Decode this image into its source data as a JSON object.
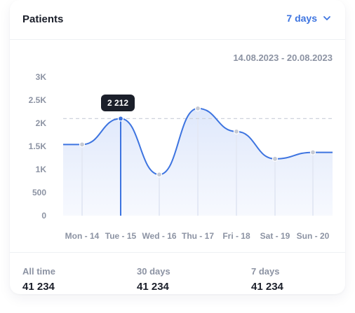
{
  "card": {
    "title": "Patients",
    "range_select": {
      "label": "7 days",
      "icon": "chevron-down-icon"
    },
    "date_range": "14.08.2023 - 20.08.2023"
  },
  "chart_data": {
    "type": "area",
    "categories": [
      "Mon - 14",
      "Tue - 15",
      "Wed - 16",
      "Thu - 17",
      "Fri - 18",
      "Sat - 19",
      "Sun - 20"
    ],
    "values": [
      1540,
      2100,
      890,
      2320,
      1820,
      1230,
      1370
    ],
    "y_ticks": [
      "0",
      "500",
      "1K",
      "1.5K",
      "2K",
      "2.5K",
      "3K"
    ],
    "ylim": [
      0,
      3000
    ],
    "highlight_index": 1,
    "tooltip": "2 212",
    "reference_value": 2100,
    "colors": {
      "line": "#3d74e0",
      "fill_top": "#dfe8fb",
      "fill_bottom": "#f7f9fe",
      "point": "#c5c9d3",
      "drop_line": "#e4e9f5",
      "highlight_line": "#3d74e0",
      "reference_line": "#cfd3dc",
      "axis_text": "#8c93a3",
      "tooltip_bg": "#1b1f2a"
    }
  },
  "footer": {
    "stats": [
      {
        "label": "All time",
        "value": "41 234"
      },
      {
        "label": "30 days",
        "value": "41 234"
      },
      {
        "label": "7 days",
        "value": "41 234"
      }
    ]
  }
}
